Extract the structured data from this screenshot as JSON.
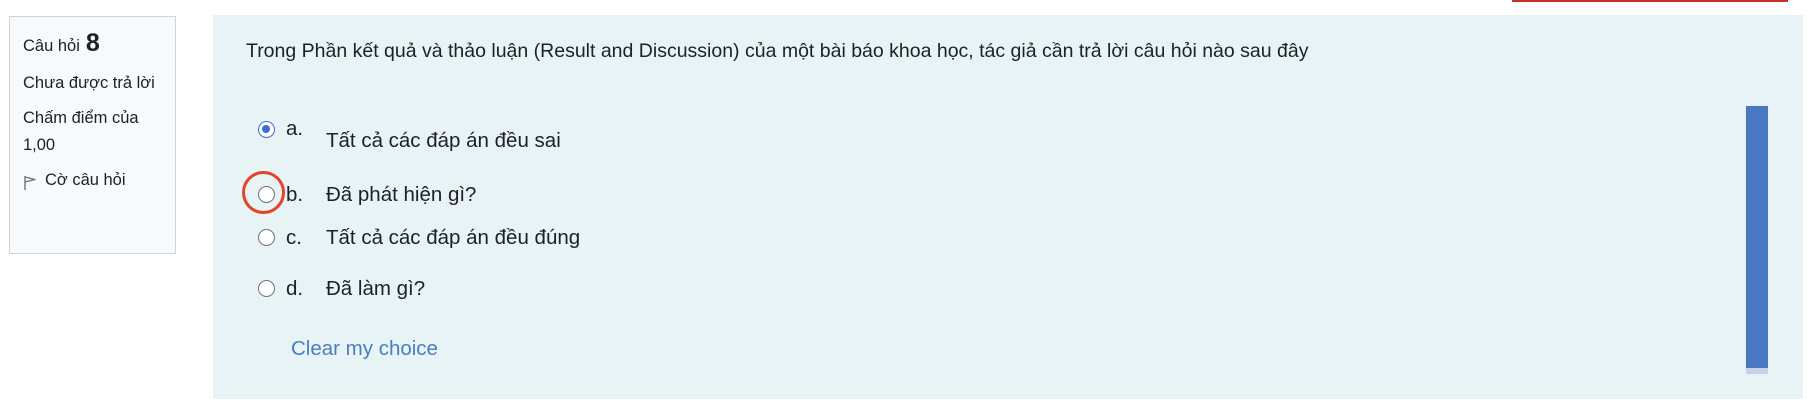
{
  "info": {
    "question_label": "Câu hỏi",
    "question_number": "8",
    "status": "Chưa được trả lời",
    "grade_label": "Chấm điểm của",
    "grade_value": "1,00",
    "flag_label": "Cờ câu hỏi",
    "flag_icon": "flag-outline-icon"
  },
  "question": {
    "text": "Trong Phần kết quả và thảo luận (Result and Discussion) của một bài báo khoa học, tác giả cần trả lời câu hỏi nào sau đây"
  },
  "answers": [
    {
      "letter": "a.",
      "text": "Tất cả các đáp án đều sai",
      "selected": true
    },
    {
      "letter": "b.",
      "text": "Đã phát hiện gì?",
      "selected": false
    },
    {
      "letter": "c.",
      "text": "Tất cả các đáp án đều đúng",
      "selected": false
    },
    {
      "letter": "d.",
      "text": "Đã làm gì?",
      "selected": false
    }
  ],
  "clear_choice_label": "Clear my choice",
  "colors": {
    "accent": "#3b6fd6",
    "link": "#4a7fbf",
    "panel_bg": "#e7f3f5",
    "highlight_ring": "#e2432b",
    "scroll_bar": "#4a77c4"
  }
}
